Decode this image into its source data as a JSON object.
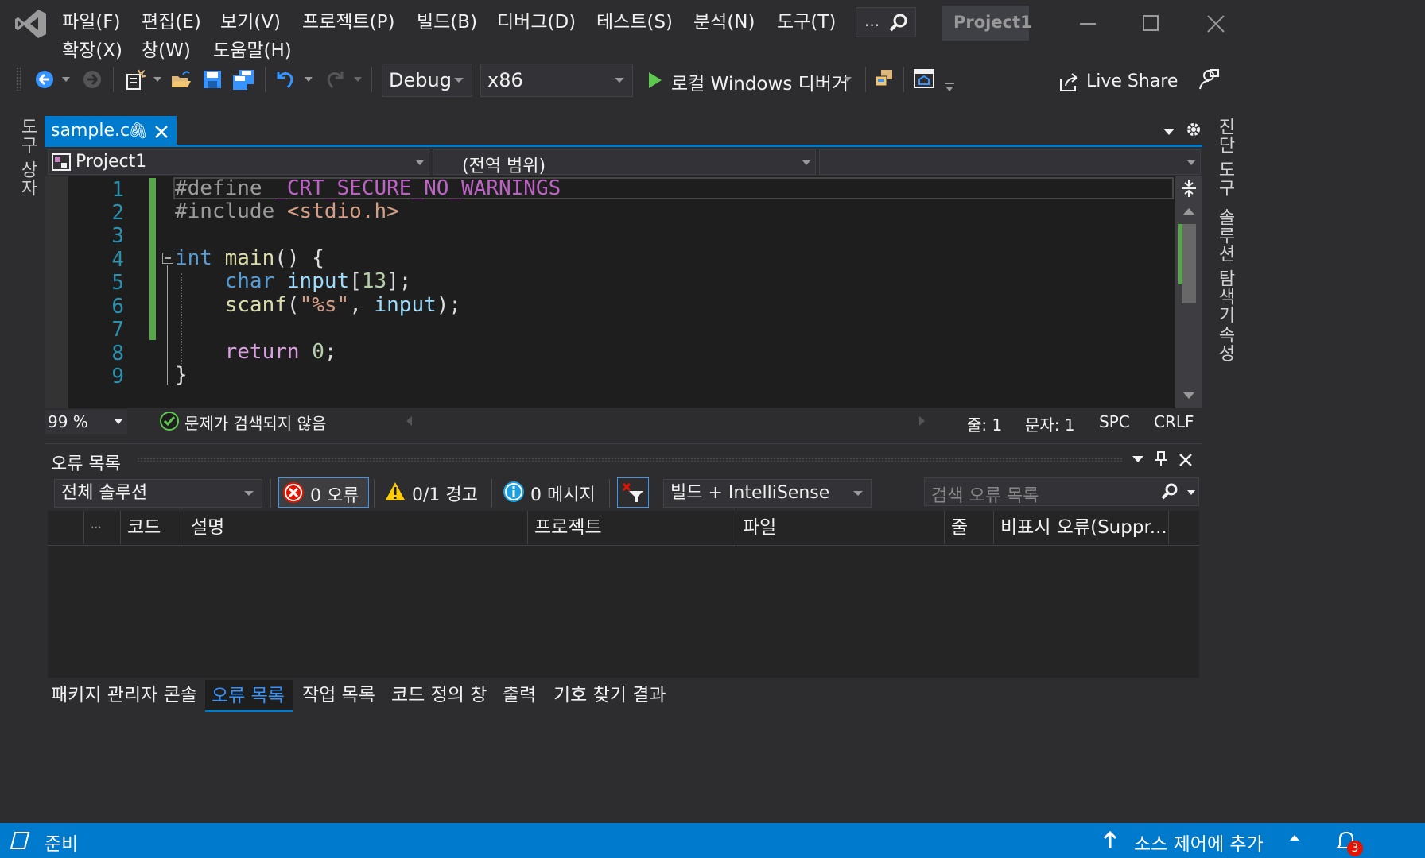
{
  "window": {
    "project_title": "Project1"
  },
  "menu": {
    "row1": [
      "파일(F)",
      "편집(E)",
      "보기(V)",
      "프로젝트(P)",
      "빌드(B)",
      "디버그(D)",
      "테스트(S)",
      "분석(N)",
      "도구(T)"
    ],
    "row2": [
      "확장(X)",
      "창(W)",
      "도움말(H)"
    ],
    "search_label": "..."
  },
  "toolbar": {
    "config": "Debug",
    "platform": "x86",
    "run_label": "로컬 Windows 디버거",
    "live_share": "Live Share"
  },
  "side_left": {
    "toolbox": "도구 상자"
  },
  "side_right": {
    "diagnostics": "진단 도구",
    "solution_explorer": "솔루션 탐색기",
    "properties": "속성"
  },
  "editor": {
    "tab_name": "sample.c",
    "nav_project": "Project1",
    "nav_scope": "(전역 범위)",
    "line_numbers": [
      "1",
      "2",
      "3",
      "4",
      "5",
      "6",
      "7",
      "8",
      "9"
    ],
    "zoom": "99 %",
    "issues": "문제가 검색되지 않음",
    "line": "줄: 1",
    "col": "문자: 1",
    "spc": "SPC",
    "eol": "CRLF"
  },
  "error_list": {
    "title": "오류 목록",
    "scope": "전체 솔루션",
    "errors": "0 오류",
    "warnings": "0/1 경고",
    "messages": "0 메시지",
    "build_filter": "빌드 + IntelliSense",
    "search_placeholder": "검색 오류 목록",
    "columns": [
      "코드",
      "설명",
      "프로젝트",
      "파일",
      "줄",
      "비표시 오류(Suppr..."
    ]
  },
  "bottom_tabs": [
    "패키지 관리자 콘솔",
    "오류 목록",
    "작업 목록",
    "코드 정의 창",
    "출력",
    "기호 찾기 결과"
  ],
  "statusbar": {
    "ready": "준비",
    "source_control": "소스 제어에 추가",
    "notifications": "3"
  },
  "colors": {
    "accent": "#007acc",
    "background": "#2d2d30",
    "editor_bg": "#1e1e1e"
  }
}
